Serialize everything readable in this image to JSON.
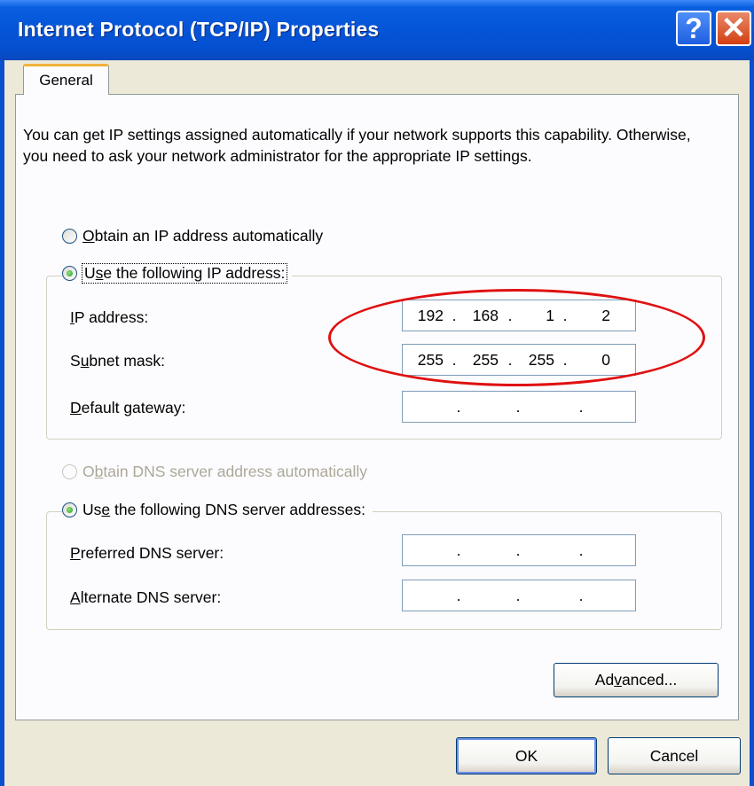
{
  "window": {
    "title": "Internet Protocol (TCP/IP) Properties",
    "help_glyph": "?",
    "close_glyph": "✕"
  },
  "tabs": [
    {
      "label": "General"
    }
  ],
  "description": "You can get IP settings assigned automatically if your network supports this capability. Otherwise, you need to ask your network administrator for the appropriate IP settings.",
  "ip_section": {
    "auto_radio": {
      "mnemonic": "O",
      "rest": "btain an IP address automatically",
      "selected": false
    },
    "manual_radio": {
      "pre": "U",
      "mnemonic": "s",
      "rest": "e the following IP address:",
      "selected": true
    },
    "ip_address": {
      "mnemonic": "I",
      "rest": "P address:",
      "octets": [
        "192",
        "168",
        "1",
        "2"
      ]
    },
    "subnet_mask": {
      "pre": "S",
      "mnemonic": "u",
      "rest": "bnet mask:",
      "octets": [
        "255",
        "255",
        "255",
        "0"
      ]
    },
    "default_gateway": {
      "mnemonic": "D",
      "rest": "efault gateway:",
      "octets": [
        "",
        "",
        "",
        ""
      ]
    }
  },
  "dns_section": {
    "auto_radio": {
      "pre": "O",
      "mnemonic": "b",
      "rest": "tain DNS server address automatically",
      "enabled": false
    },
    "manual_radio": {
      "pre": "Us",
      "mnemonic": "e",
      "rest": " the following DNS server addresses:",
      "selected": true
    },
    "preferred": {
      "mnemonic": "P",
      "rest": "referred DNS server:",
      "octets": [
        "",
        "",
        "",
        ""
      ]
    },
    "alternate": {
      "mnemonic": "A",
      "rest": "lternate DNS server:",
      "octets": [
        "",
        "",
        "",
        ""
      ]
    }
  },
  "buttons": {
    "advanced": {
      "pre": "Ad",
      "mnemonic": "v",
      "rest": "anced..."
    },
    "ok": "OK",
    "cancel": "Cancel"
  },
  "ip_separator": ".",
  "colors": {
    "titlebar": "#0553d6",
    "dialog_bg": "#ece9d8",
    "tab_highlight": "#f0b33c",
    "annotation_ellipse": "#e01010"
  }
}
